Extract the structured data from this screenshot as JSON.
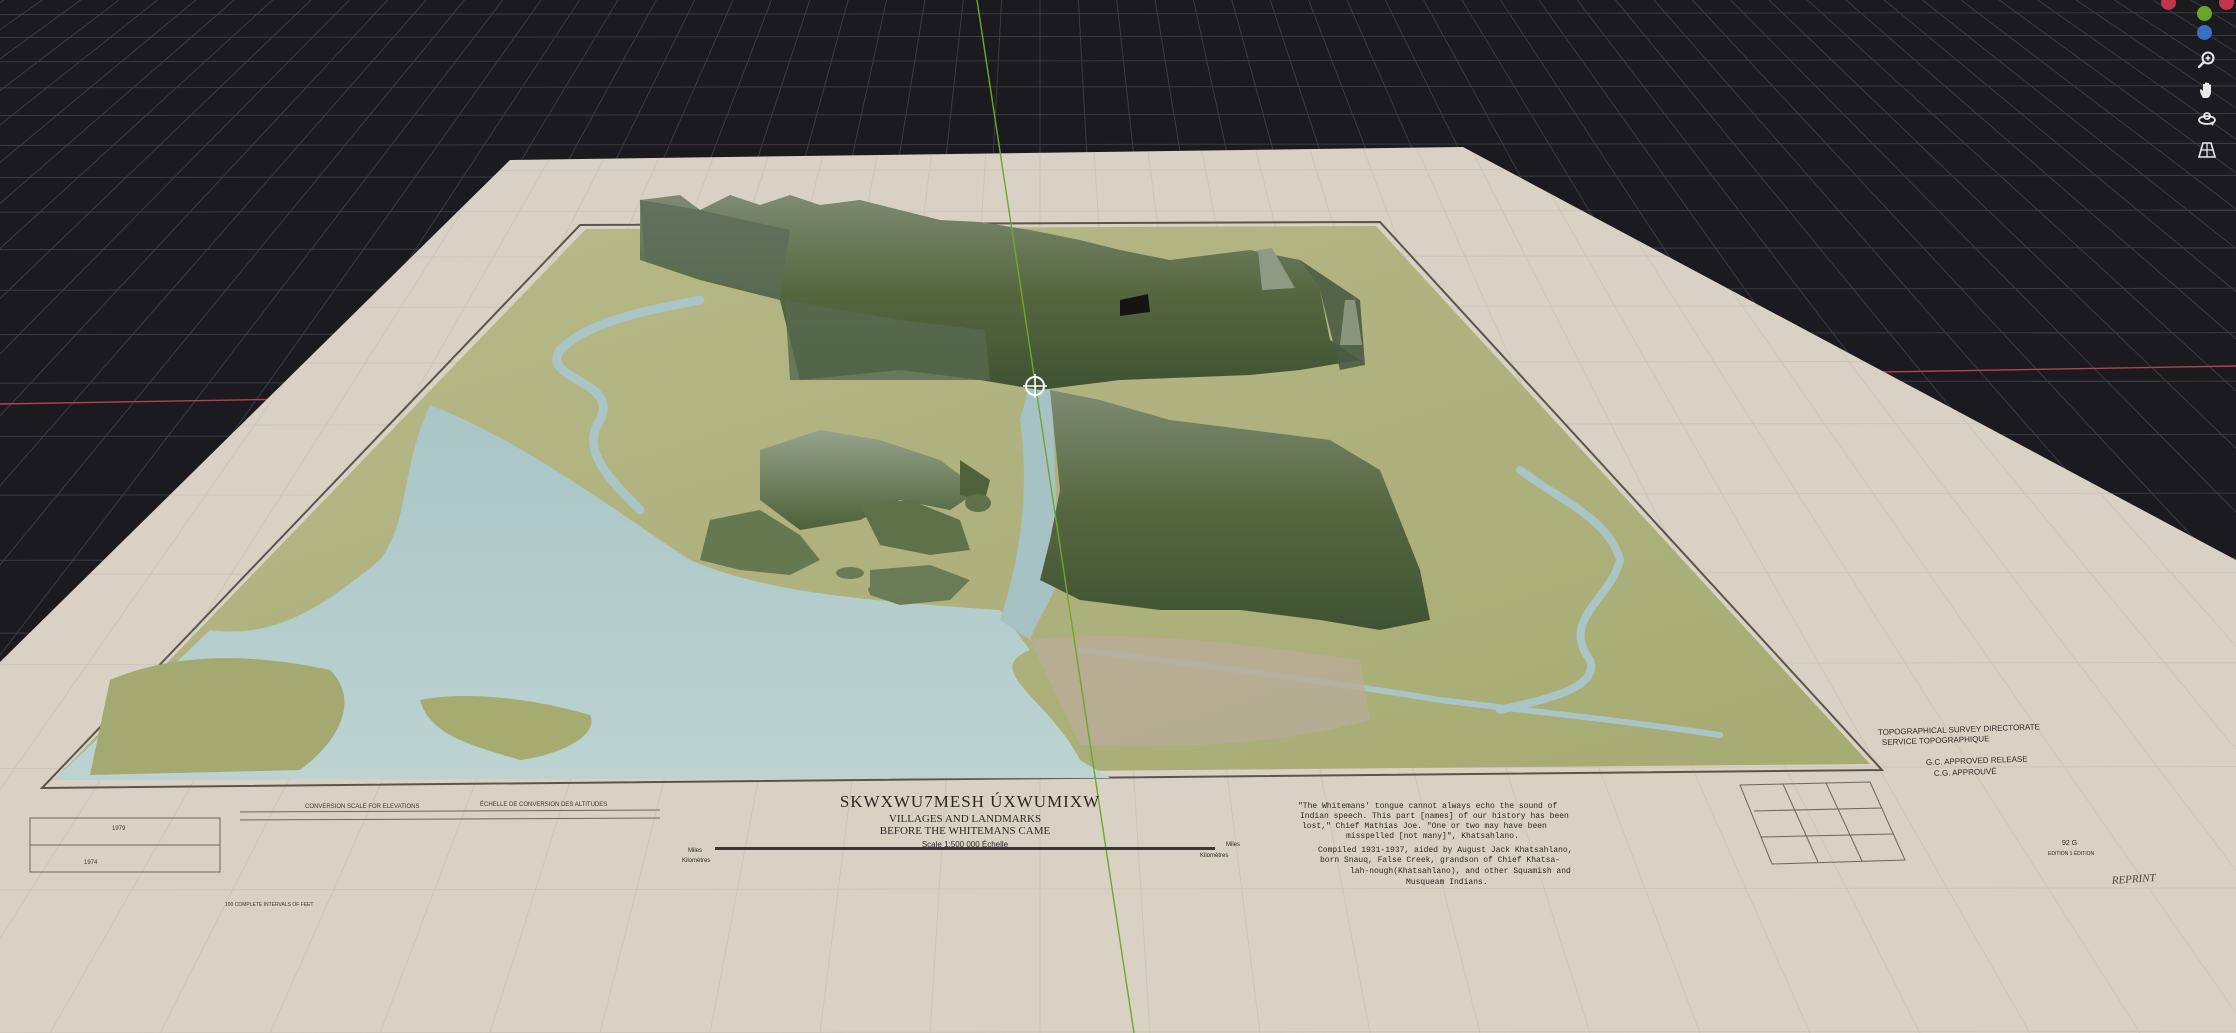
{
  "viewport": {
    "background_color": "#1b1a1f",
    "grid_color": "#3a3b46",
    "x_axis_color": "#b3424a",
    "y_axis_color": "#6da82c",
    "paper_color": "#d9d1c4"
  },
  "map_sheet": {
    "title": "SKWXWU7MESH ÚXWUMIXW",
    "subtitle_line1": "VILLAGES AND LANDMARKS",
    "subtitle_line2": "BEFORE THE WHITEMANS CAME",
    "scale_label": "Scale 1:500 000 Échelle",
    "scale_left_unit": "Miles",
    "scale_right_unit": "Miles",
    "scale_left_km": "Kilomètres",
    "scale_right_km": "Kilomètres",
    "elevation_header_left": "CONVERSION SCALE FOR ELEVATIONS",
    "elevation_header_right": "ÉCHELLE DE CONVERSION DES ALTITUDES",
    "contour_note": "100 COMPLETE INTERVALS OF FEET",
    "quote_line1": "\"The Whitemans' tongue cannot always echo the sound of",
    "quote_line2": "Indian speech. This part [names] of our history has been",
    "quote_line3": "lost,\" Chief Mathias Joe. \"One or two may have been",
    "quote_line4": "misspelled [not many]\", Khatsahlano.",
    "compiled_line1": "Compiled 1931-1937, aided by August Jack Khatsahlano,",
    "compiled_line2": "born Snauq, False Creek, grandson of Chief Khatsa-",
    "compiled_line3": "lah-nough(Khatsahlano), and other Squamish and",
    "compiled_line4": "Musqueam Indians.",
    "survey_line1": "TOPOGRAPHICAL SURVEY DIRECTORATE",
    "survey_line2": "SERVICE TOPOGRAPHIQUE",
    "approved_line1": "G.C. APPROVED RELEASE",
    "approved_line2": "C.G. APPROUVÉ",
    "handwritten_date": "REPRINT",
    "left_box_upper": "1979",
    "left_box_lower": "1974",
    "sheet_number": "92 G",
    "edition_note": "EDITION 1 ÉDITION"
  },
  "toolbar": {
    "gizmo_colors": [
      "#c0364a",
      "#6aa52b",
      "#3b6fc2",
      "#c0364a"
    ],
    "tools": [
      {
        "name": "zoom-tool",
        "icon": "zoom-icon"
      },
      {
        "name": "pan-tool",
        "icon": "hand-icon"
      },
      {
        "name": "orbit-tool",
        "icon": "orbit-icon"
      },
      {
        "name": "perspective-tool",
        "icon": "grid-perspective-icon"
      }
    ]
  }
}
